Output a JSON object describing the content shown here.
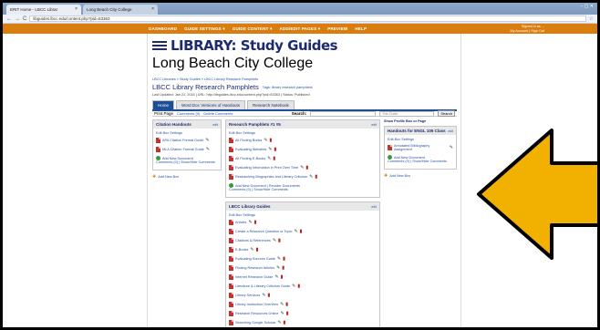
{
  "browser": {
    "tabs": [
      {
        "label": "ERIT Home - LBCC Librar",
        "active": true
      },
      {
        "label": "Long Beach City College",
        "active": false
      }
    ],
    "window_controls": "– ▢ ✕",
    "url": "libguides.lbcc.edu/content.php?pid=53363",
    "back": "←",
    "forward": "→",
    "reload": "C",
    "star": "☆"
  },
  "sitenav": {
    "items": [
      "DASHBOARD",
      "GUIDE SETTINGS ▾",
      "GUIDE CONTENT ▾",
      "ADD/EDIT PAGES ▾",
      "PREVIEW",
      "HELP"
    ],
    "user_line1": "Signed in as ...",
    "user_line2": "My Account | Sign Out"
  },
  "header": {
    "title": "LIBRARY:  Study Guides",
    "subtitle": "Long Beach City College",
    "breadcrumb": "LBCC Libraries » Study Guides » LBCC Library Research Pamphlets",
    "guide_title": "LBCC Library Research Pamphlets",
    "guide_title_note": "Tags: library research pamphlets",
    "meta": "Last Updated: Jan 21, 2015  |  URL: http://libguides.lbcc.edu/content.php?pid=53363  |  Status: Published"
  },
  "tabs": [
    {
      "label": "Home",
      "active": true
    },
    {
      "label": "Word Doc Versions of Handouts",
      "active": false
    },
    {
      "label": "Research Notebook",
      "active": false
    }
  ],
  "toolbar": {
    "print": "Print Page",
    "comments": "Comments (0)",
    "delete": "Delete Comments",
    "search_label": "Search:",
    "select_value": "This Guide",
    "go": "Search"
  },
  "col1": {
    "header": "Citation Handouts",
    "edit_label": "edit",
    "edit_box": "Edit Box Settings",
    "items": [
      "APA Citation Format Guide",
      "MLA Citation Format Guide"
    ],
    "add_doc": "Add New Document",
    "add_doc_links": "Comments (0)  |  Show/Hide Comments",
    "add_box": "Add New Box"
  },
  "col2": {
    "boxes": [
      {
        "header": "Research Pamphlets #1 #5",
        "edit_label": "edit",
        "edit_box": "Edit Box Settings",
        "items": [
          "All Finding Books",
          "Evaluating Websites",
          "All Finding E-Books",
          "Evaluating Information in Print Over Time",
          "Researching Biographies and Literary Criticism"
        ],
        "add_doc": "Add New Document  |  Reorder Documents",
        "add_doc_links": "Comments (0)  |  Show/Hide Comments"
      },
      {
        "header": "LBCC Library Guides",
        "edit_label": "edit",
        "edit_box": "Edit Box Settings",
        "items": [
          "Articles",
          "Create a Research Question or Topic",
          "Citations & References",
          "E-Books",
          "Evaluating Sources Guide",
          "Finding Research Articles",
          "Internet Research Guide",
          "Literature & Literary Criticism Guide",
          "Library Services",
          "Library Instruction Overview",
          "Research Resources Online",
          "Searching Google Scholar"
        ]
      }
    ]
  },
  "col3": {
    "show_profile": "Show Profile Box or Page",
    "header": "Handouts for ENGL 105 Class",
    "edit_label": "edit",
    "edit_box": "Edit Box Settings",
    "items": [
      "Annotated Bibliography Assignment"
    ],
    "add_doc": "Add New Document",
    "add_doc_links": "Comments (0)  |  Show/Hide Comments",
    "add_box": "Add New Box"
  },
  "colors": {
    "sitenav": "#d97d0e",
    "arrow_fill": "#f2b000",
    "arrow_stroke": "#000000",
    "brand": "#1c2a6e"
  }
}
